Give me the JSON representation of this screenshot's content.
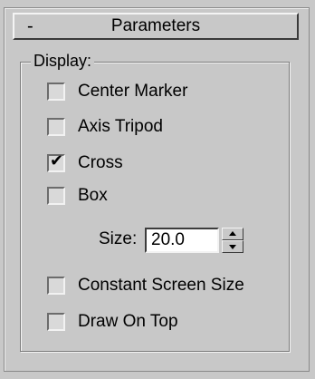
{
  "rollout": {
    "toggle": "-",
    "title": "Parameters"
  },
  "display_group": {
    "label": "Display:"
  },
  "checkboxes": {
    "center_marker": {
      "label": "Center Marker",
      "checked": false
    },
    "axis_tripod": {
      "label": "Axis Tripod",
      "checked": false
    },
    "cross": {
      "label": "Cross",
      "checked": true
    },
    "box": {
      "label": "Box",
      "checked": false
    },
    "constant_screen_size": {
      "label": "Constant Screen Size",
      "checked": false
    },
    "draw_on_top": {
      "label": "Draw On Top",
      "checked": false
    }
  },
  "size": {
    "label": "Size:",
    "value": "20.0"
  },
  "icons": {
    "check": "checkmark-icon",
    "spin_up": "triangle-up-icon",
    "spin_down": "triangle-down-icon"
  }
}
